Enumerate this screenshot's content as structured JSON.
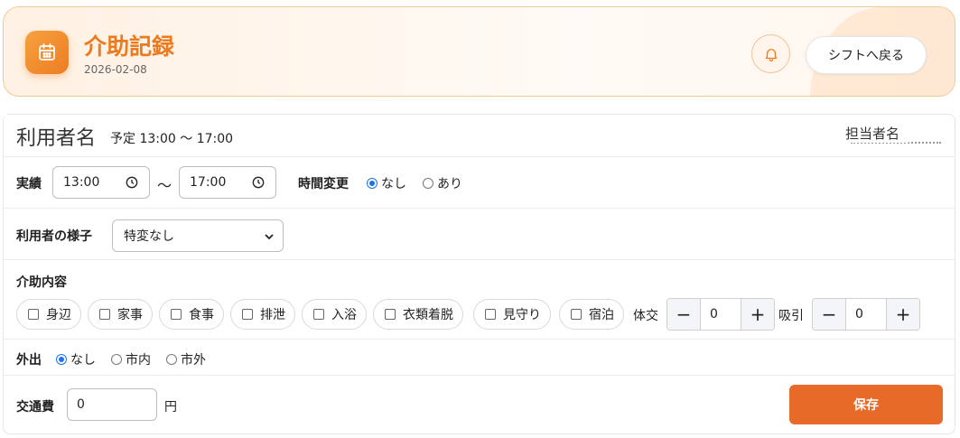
{
  "header": {
    "title": "介助記録",
    "date": "2026-02-08",
    "back_label": "シフトへ戻る"
  },
  "user": {
    "name": "利用者名",
    "schedule": "予定 13:00 〜 17:00",
    "staff_label": "担当者名"
  },
  "actual": {
    "label": "実績",
    "start": "13:00",
    "separator": "〜",
    "end": "17:00",
    "time_change_label": "時間変更",
    "options": [
      "なし",
      "あり"
    ],
    "selected": "なし"
  },
  "condition": {
    "label": "利用者の様子",
    "selected": "特変なし"
  },
  "care": {
    "label": "介助内容",
    "items": [
      "身辺",
      "家事",
      "食事",
      "排泄",
      "入浴",
      "衣類着脱",
      "見守り",
      "宿泊"
    ],
    "turning_label": "体交",
    "turning_value": "0",
    "suction_label": "吸引",
    "suction_value": "0",
    "minus": "−",
    "plus": "+"
  },
  "outing": {
    "label": "外出",
    "options": [
      "なし",
      "市内",
      "市外"
    ],
    "selected": "なし"
  },
  "transport": {
    "label": "交通費",
    "value": "0",
    "unit": "円",
    "save_label": "保存"
  },
  "colors": {
    "accent": "#ec7a1e",
    "save": "#e86a28",
    "radio": "#1a73e8"
  },
  "icons": [
    "calendar-icon",
    "bell-icon",
    "clock-icon",
    "chevron-down-icon"
  ]
}
